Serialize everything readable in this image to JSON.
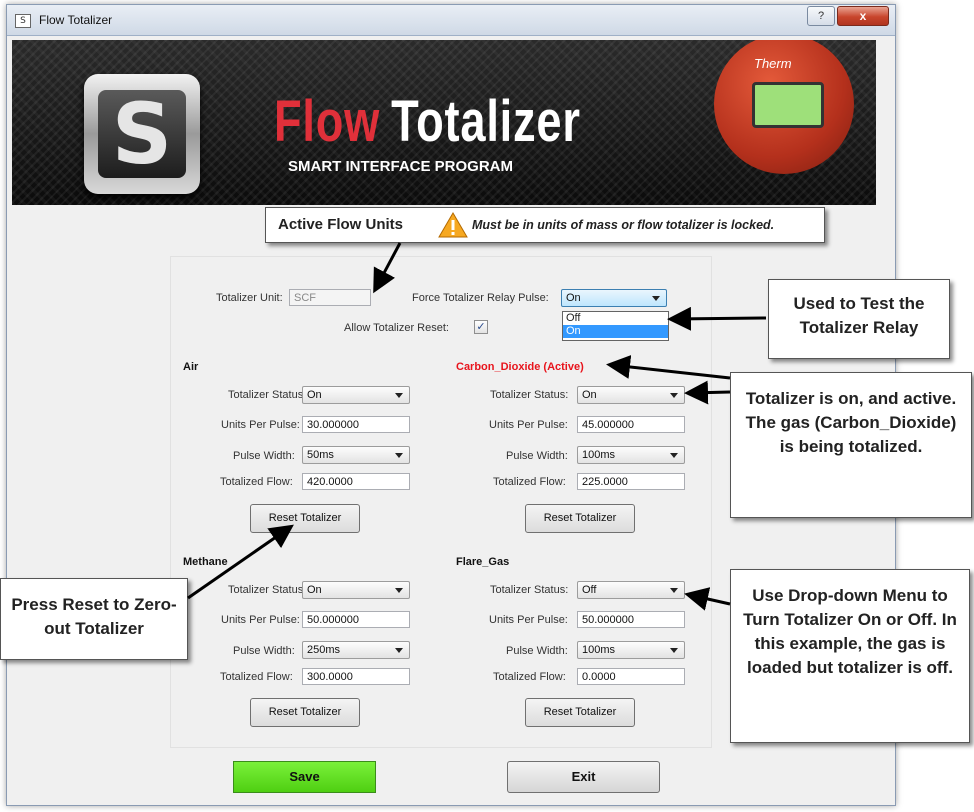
{
  "window": {
    "title": "Flow Totalizer",
    "help_label": "?",
    "close_label": "x"
  },
  "banner": {
    "title_flow": "Flow",
    "title_totalizer": "Totalizer",
    "subtitle": "SMART INTERFACE PROGRAM",
    "device_brand": "Therm"
  },
  "active_units_callout": {
    "heading": "Active Flow Units",
    "warning": "Must be in units of mass or flow totalizer is locked."
  },
  "settings": {
    "totalizer_unit_label": "Totalizer Unit:",
    "totalizer_unit_value": "SCF",
    "relay_pulse_label": "Force Totalizer Relay Pulse:",
    "relay_pulse_value": "On",
    "relay_pulse_options": [
      "Off",
      "On"
    ],
    "allow_reset_label": "Allow Totalizer Reset:",
    "allow_reset_checked": "✓"
  },
  "field_labels": {
    "status": "Totalizer Status:",
    "units_per_pulse": "Units Per Pulse:",
    "pulse_width": "Pulse Width:",
    "totalized_flow": "Totalized Flow:",
    "reset_button": "Reset Totalizer"
  },
  "gases": [
    {
      "name": "Air",
      "status": "On",
      "units_per_pulse": "30.000000",
      "pulse_width": "50ms",
      "totalized_flow": "420.0000"
    },
    {
      "name": "Carbon_Dioxide (Active)",
      "status": "On",
      "units_per_pulse": "45.000000",
      "pulse_width": "100ms",
      "totalized_flow": "225.0000",
      "active": true
    },
    {
      "name": "Methane",
      "status": "On",
      "units_per_pulse": "50.000000",
      "pulse_width": "250ms",
      "totalized_flow": "300.0000"
    },
    {
      "name": "Flare_Gas",
      "status": "Off",
      "units_per_pulse": "50.000000",
      "pulse_width": "100ms",
      "totalized_flow": "0.0000"
    }
  ],
  "buttons": {
    "save": "Save",
    "exit": "Exit"
  },
  "callouts": {
    "relay_test": "Used to Test the Totalizer Relay",
    "active_gas": "Totalizer is on, and active. The gas (Carbon_Dioxide) is being totalized.",
    "reset": "Press Reset to Zero-out Totalizer",
    "dropdown": "Use Drop-down Menu to Turn Totalizer On or Off. In this example, the gas is loaded but totalizer is off."
  },
  "colors": {
    "active_gas": "#e8141c",
    "save_button": "#5ad81c",
    "title_red": "#e0303a"
  }
}
